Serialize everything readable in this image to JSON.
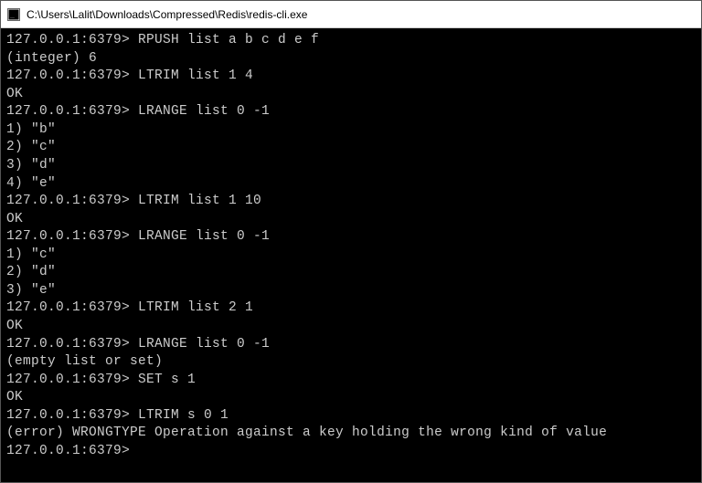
{
  "window": {
    "title": "C:\\Users\\Lalit\\Downloads\\Compressed\\Redis\\redis-cli.exe"
  },
  "prompt": "127.0.0.1:6379>",
  "lines": [
    {
      "type": "cmd",
      "text": "RPUSH list a b c d e f"
    },
    {
      "type": "out",
      "text": "(integer) 6"
    },
    {
      "type": "cmd",
      "text": "LTRIM list 1 4"
    },
    {
      "type": "out",
      "text": "OK"
    },
    {
      "type": "cmd",
      "text": "LRANGE list 0 -1"
    },
    {
      "type": "out",
      "text": "1) \"b\""
    },
    {
      "type": "out",
      "text": "2) \"c\""
    },
    {
      "type": "out",
      "text": "3) \"d\""
    },
    {
      "type": "out",
      "text": "4) \"e\""
    },
    {
      "type": "cmd",
      "text": "LTRIM list 1 10"
    },
    {
      "type": "out",
      "text": "OK"
    },
    {
      "type": "cmd",
      "text": "LRANGE list 0 -1"
    },
    {
      "type": "out",
      "text": "1) \"c\""
    },
    {
      "type": "out",
      "text": "2) \"d\""
    },
    {
      "type": "out",
      "text": "3) \"e\""
    },
    {
      "type": "cmd",
      "text": "LTRIM list 2 1"
    },
    {
      "type": "out",
      "text": "OK"
    },
    {
      "type": "cmd",
      "text": "LRANGE list 0 -1"
    },
    {
      "type": "out",
      "text": "(empty list or set)"
    },
    {
      "type": "cmd",
      "text": "SET s 1"
    },
    {
      "type": "out",
      "text": "OK"
    },
    {
      "type": "cmd",
      "text": "LTRIM s 0 1"
    },
    {
      "type": "out",
      "text": "(error) WRONGTYPE Operation against a key holding the wrong kind of value"
    },
    {
      "type": "cmd",
      "text": ""
    }
  ]
}
